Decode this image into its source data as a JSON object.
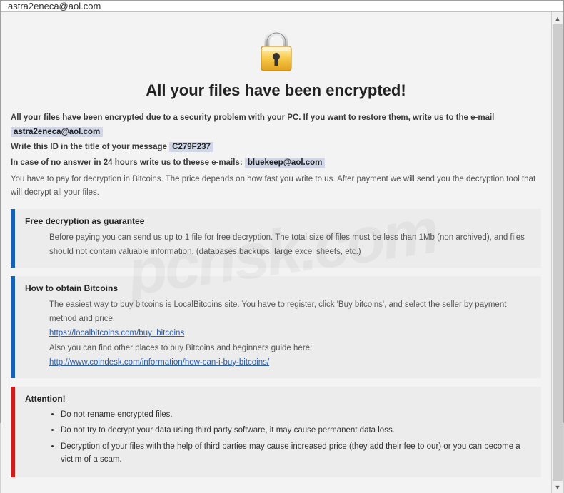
{
  "title": "astra2eneca@aol.com",
  "heading": "All your files have been encrypted!",
  "intro": {
    "line1_prefix": "All your files have been encrypted due to a security problem with your PC. If you want to restore them, write us to the e-mail ",
    "email1": "astra2eneca@aol.com",
    "line2_prefix": "Write this ID in the title of your message ",
    "id": "C279F237",
    "line3_prefix": "In case of no answer in 24 hours write us to theese e-mails: ",
    "email2": "bluekeep@aol.com",
    "payline": "You have to pay for decryption in Bitcoins. The price depends on how fast you write to us. After payment we will send you the decryption tool that will decrypt all your files."
  },
  "section_free": {
    "title": "Free decryption as guarantee",
    "body": "Before paying you can send us up to 1 file for free decryption. The total size of files must be less than 1Mb (non archived), and files should not contain valuable information. (databases,backups, large excel sheets, etc.)"
  },
  "section_btc": {
    "title": "How to obtain Bitcoins",
    "line1": "The easiest way to buy bitcoins is LocalBitcoins site. You have to register, click 'Buy bitcoins', and select the seller by payment method and price.",
    "link1": "https://localbitcoins.com/buy_bitcoins",
    "line2": "Also you can find other places to buy Bitcoins and beginners guide here:",
    "link2": "http://www.coindesk.com/information/how-can-i-buy-bitcoins/"
  },
  "section_attention": {
    "title": "Attention!",
    "bullets": [
      "Do not rename encrypted files.",
      "Do not try to decrypt your data using third party software, it may cause permanent data loss.",
      "Decryption of your files with the help of third parties may cause increased price (they add their fee to our) or you can become a victim of a scam."
    ]
  },
  "watermark": "pcrisk.com"
}
